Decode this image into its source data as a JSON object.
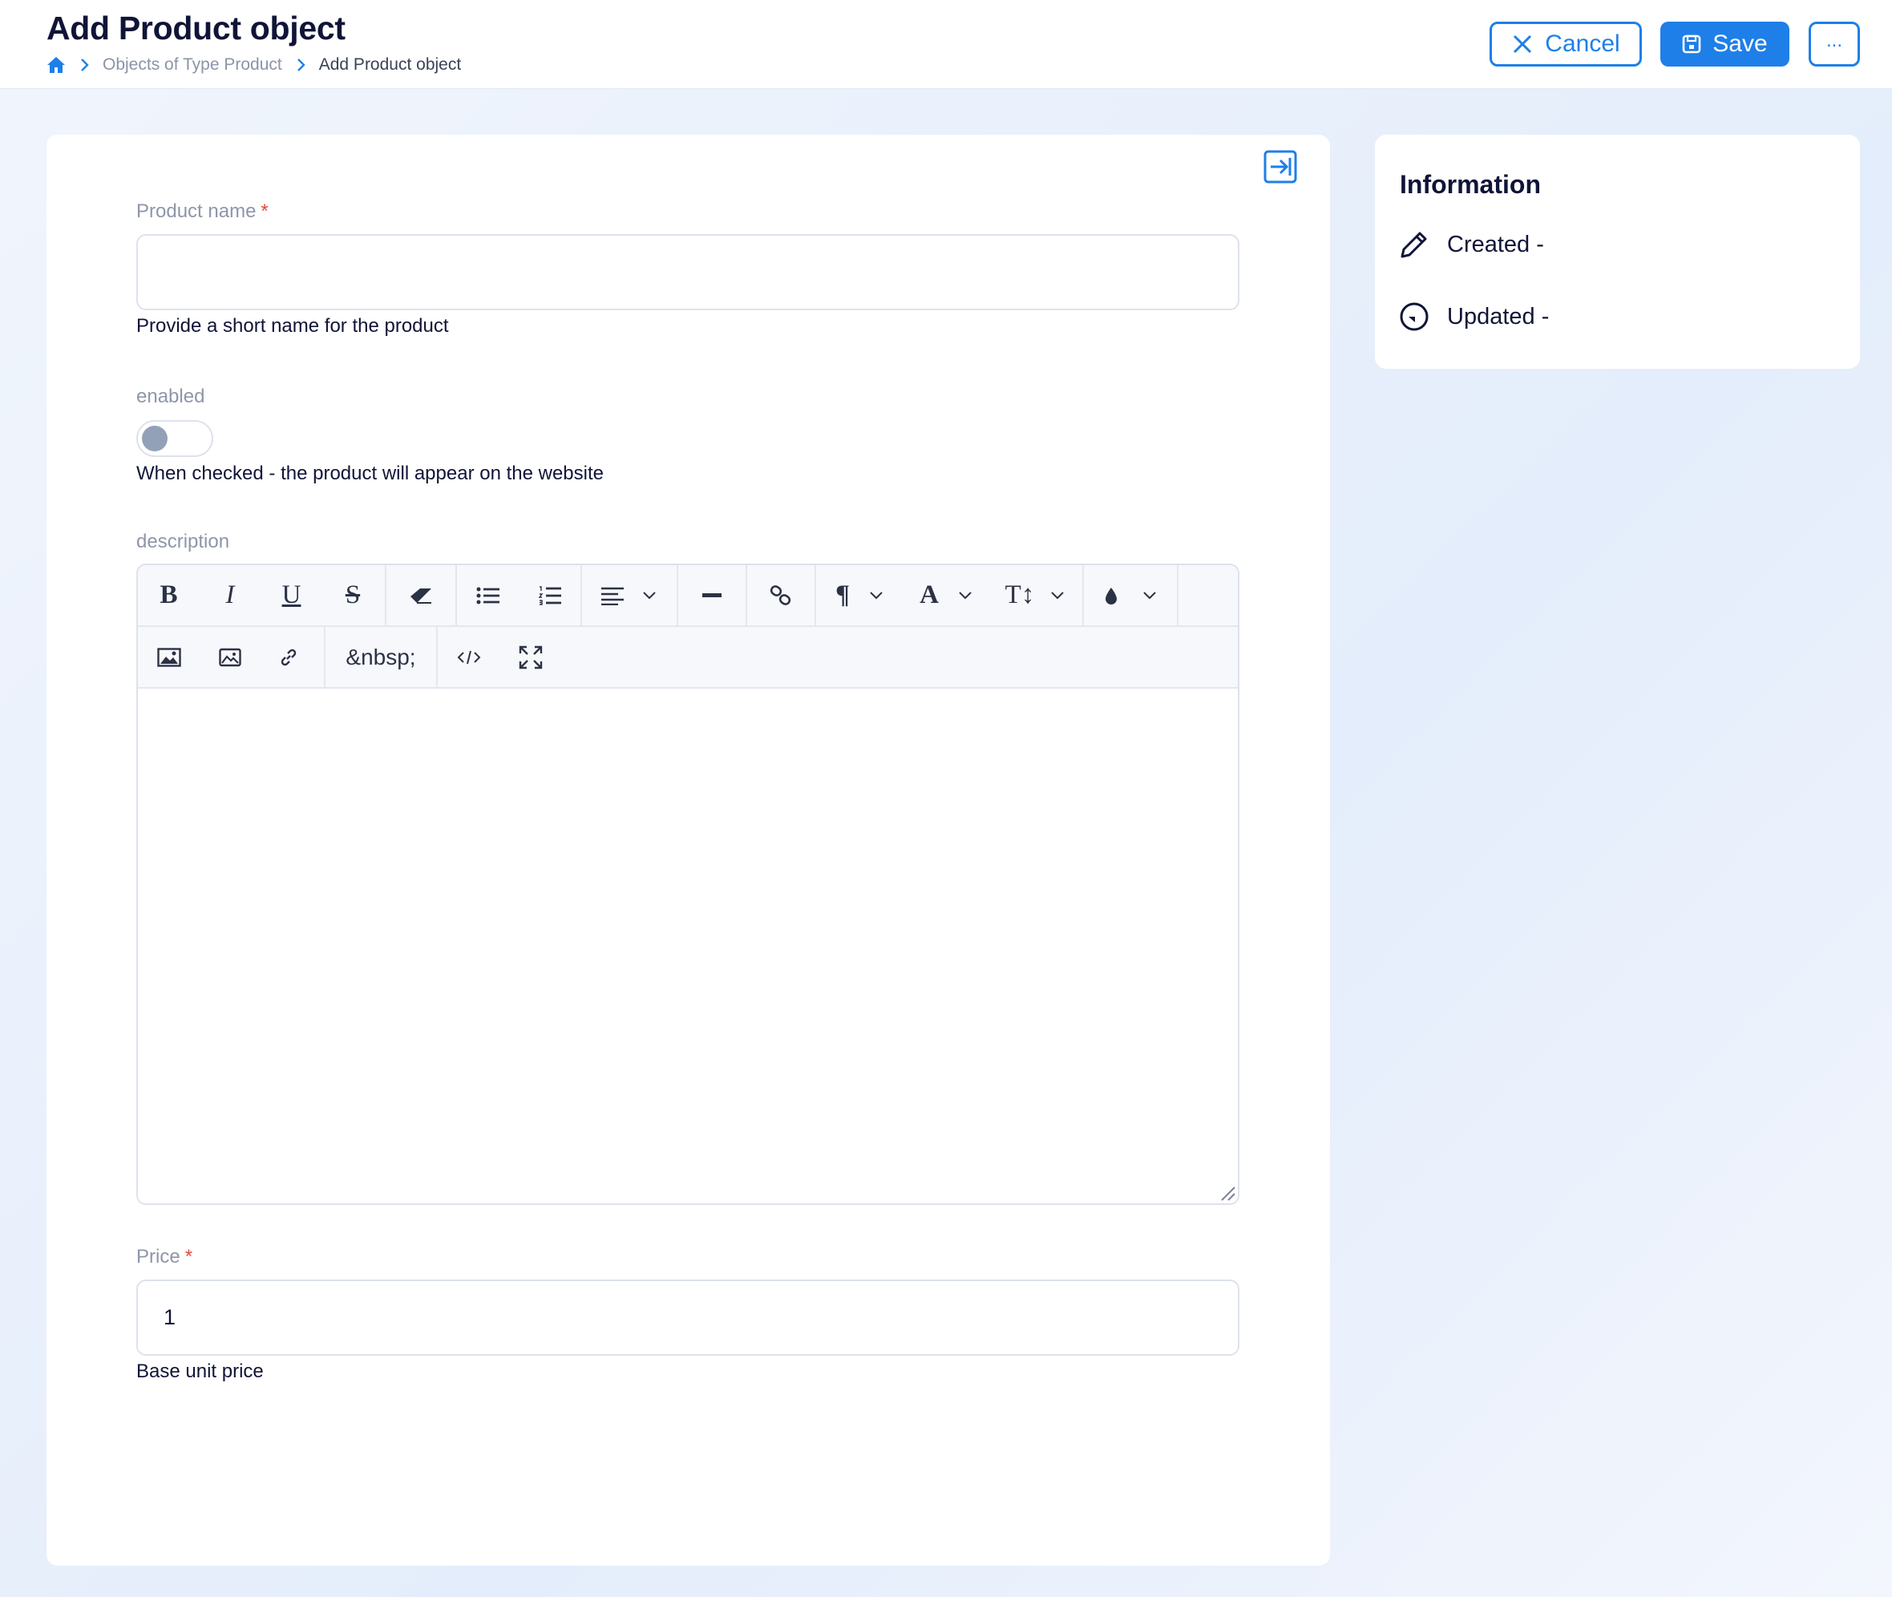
{
  "header": {
    "title": "Add Product object",
    "breadcrumb": {
      "items": [
        {
          "label": "Objects of Type Product"
        },
        {
          "label": "Add Product object"
        }
      ]
    },
    "actions": {
      "cancel_label": "Cancel",
      "save_label": "Save",
      "more_label": "..."
    },
    "accent_color": "#1e7fe8"
  },
  "form": {
    "product_name": {
      "label": "Product name",
      "required_mark": "*",
      "value": "",
      "help": "Provide a short name for the product"
    },
    "enabled": {
      "label": "enabled",
      "checked": false,
      "help": "When checked - the product will appear on the website"
    },
    "description": {
      "label": "description",
      "toolbar_row1": [
        {
          "icon": "bold-icon",
          "glyph": "B"
        },
        {
          "icon": "italic-icon",
          "glyph": "I"
        },
        {
          "icon": "underline-icon",
          "glyph": "U"
        },
        {
          "icon": "strikethrough-icon",
          "glyph": "S"
        },
        {
          "icon": "eraser-icon"
        },
        {
          "icon": "bullet-list-icon"
        },
        {
          "icon": "numbered-list-icon"
        },
        {
          "icon": "align-icon"
        },
        {
          "icon": "horizontal-rule-icon"
        },
        {
          "icon": "link-icon"
        },
        {
          "icon": "paragraph-icon",
          "glyph": "¶"
        },
        {
          "icon": "font-icon",
          "glyph": "A"
        },
        {
          "icon": "font-size-icon",
          "glyph": "T↕"
        },
        {
          "icon": "color-drop-icon"
        }
      ],
      "toolbar_row2": [
        {
          "icon": "image-icon"
        },
        {
          "icon": "gallery-icon"
        },
        {
          "icon": "link-chain-icon"
        },
        {
          "icon": "nbsp-button",
          "text": "&nbsp;"
        },
        {
          "icon": "code-view-icon"
        },
        {
          "icon": "fullscreen-icon"
        }
      ],
      "content": ""
    },
    "price": {
      "label": "Price",
      "required_mark": "*",
      "value": "1",
      "help": "Base unit price"
    }
  },
  "info": {
    "title": "Information",
    "created": "Created -",
    "updated": "Updated -"
  }
}
